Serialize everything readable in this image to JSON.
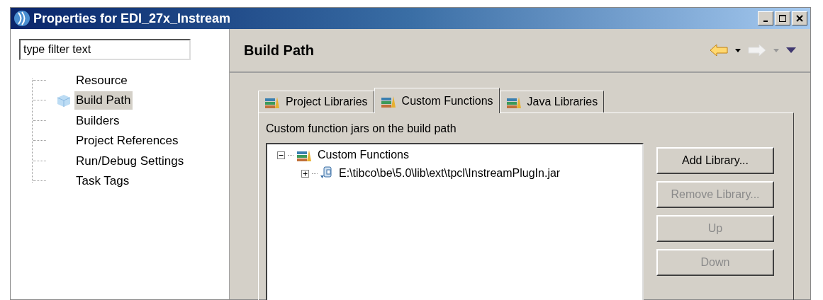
{
  "window": {
    "title": "Properties for EDI_27x_Instream"
  },
  "filter": {
    "placeholder": "type filter text"
  },
  "nav_items": [
    {
      "label": "Resource",
      "selected": false
    },
    {
      "label": "Build Path",
      "selected": true
    },
    {
      "label": "Builders",
      "selected": false
    },
    {
      "label": "Project References",
      "selected": false
    },
    {
      "label": "Run/Debug Settings",
      "selected": false
    },
    {
      "label": "Task Tags",
      "selected": false
    }
  ],
  "page": {
    "title": "Build Path",
    "back_disabled": false,
    "forward_disabled": true
  },
  "tabs": [
    {
      "label": "Project Libraries",
      "selected": false
    },
    {
      "label": "Custom Functions",
      "selected": true
    },
    {
      "label": "Java Libraries",
      "selected": false
    }
  ],
  "section_label": "Custom function jars on the build path",
  "tree": [
    {
      "label": "Custom Functions",
      "expanded": true,
      "children": [
        {
          "label": "E:\\tibco\\be\\5.0\\lib\\ext\\tpcl\\InstreamPlugIn.jar",
          "expanded": false
        }
      ]
    }
  ],
  "buttons": [
    {
      "label": "Add Library...",
      "disabled": false
    },
    {
      "label": "Remove Library...",
      "disabled": true
    },
    {
      "label": "Up",
      "disabled": true
    },
    {
      "label": "Down",
      "disabled": true
    }
  ]
}
